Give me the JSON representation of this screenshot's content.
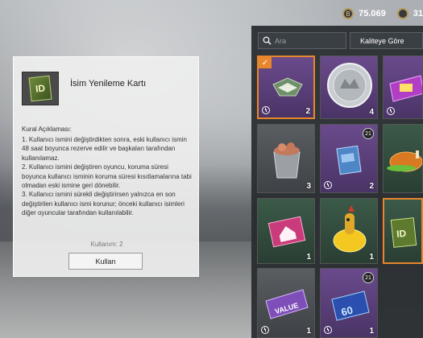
{
  "currency": {
    "amount": "75.069",
    "amount2": "31"
  },
  "card": {
    "title": "İsim Yenileme Kartı",
    "icon_label": "ID",
    "rules_heading": "Kural Açıklaması:",
    "rules": [
      "1. Kullanıcı ismini değiştirdikten sonra, eski kullanıcı ismin 48 saat boyunca rezerve edilir ve başkaları tarafından kullanılamaz.",
      "2. Kullanıcı ismini değiştiren oyuncu, koruma süresi boyunca kullanıcı isminin koruma süresi kısıtlamalarına tabi olmadan eski ismine geri dönebilir.",
      "3. Kullanıcı ismini sürekli değiştirirsen yalnızca en son değiştirilen kullanıcı ismi korunur; önceki kullanıcı isimleri diğer oyuncular tarafından kullanılabilir."
    ],
    "usage": "Kullanım: 2",
    "use_button": "Kullan"
  },
  "panel": {
    "search_placeholder": "Ara",
    "sort_label": "Kaliteye Göre"
  },
  "items": [
    {
      "icon": "emblem-wings-icon",
      "count": "2",
      "timed": true,
      "selected": true,
      "bg": "purple"
    },
    {
      "icon": "silver-coin-icon",
      "count": "4",
      "timed": false,
      "selected": false,
      "bg": "purple"
    },
    {
      "icon": "vehicle-ticket-icon",
      "count": "",
      "timed": true,
      "selected": false,
      "bg": "purple"
    },
    {
      "icon": "bucket-icon",
      "count": "3",
      "timed": false,
      "selected": false,
      "bg": "greyb"
    },
    {
      "icon": "rp-card-icon",
      "count": "2",
      "timed": true,
      "selected": false,
      "bg": "purple",
      "level": "21"
    },
    {
      "icon": "roast-chicken-icon",
      "count": "",
      "timed": false,
      "selected": false,
      "bg": "greenb"
    },
    {
      "icon": "house-card-icon",
      "count": "1",
      "timed": false,
      "selected": false,
      "bg": "greenb"
    },
    {
      "icon": "banana-character-icon",
      "count": "1",
      "timed": false,
      "selected": false,
      "bg": "greenb"
    },
    {
      "icon": "id-card-icon",
      "count": "",
      "timed": false,
      "selected": true,
      "bg": "greenb"
    },
    {
      "icon": "value-ticket-icon",
      "count": "1",
      "timed": true,
      "selected": false,
      "bg": "greyb"
    },
    {
      "icon": "upgrade-card-60-icon",
      "count": "1",
      "timed": true,
      "selected": false,
      "bg": "purple",
      "level": "21",
      "label": "60"
    }
  ],
  "labels": {
    "value_ticket": "VALUE",
    "coin_symbol": "B"
  }
}
